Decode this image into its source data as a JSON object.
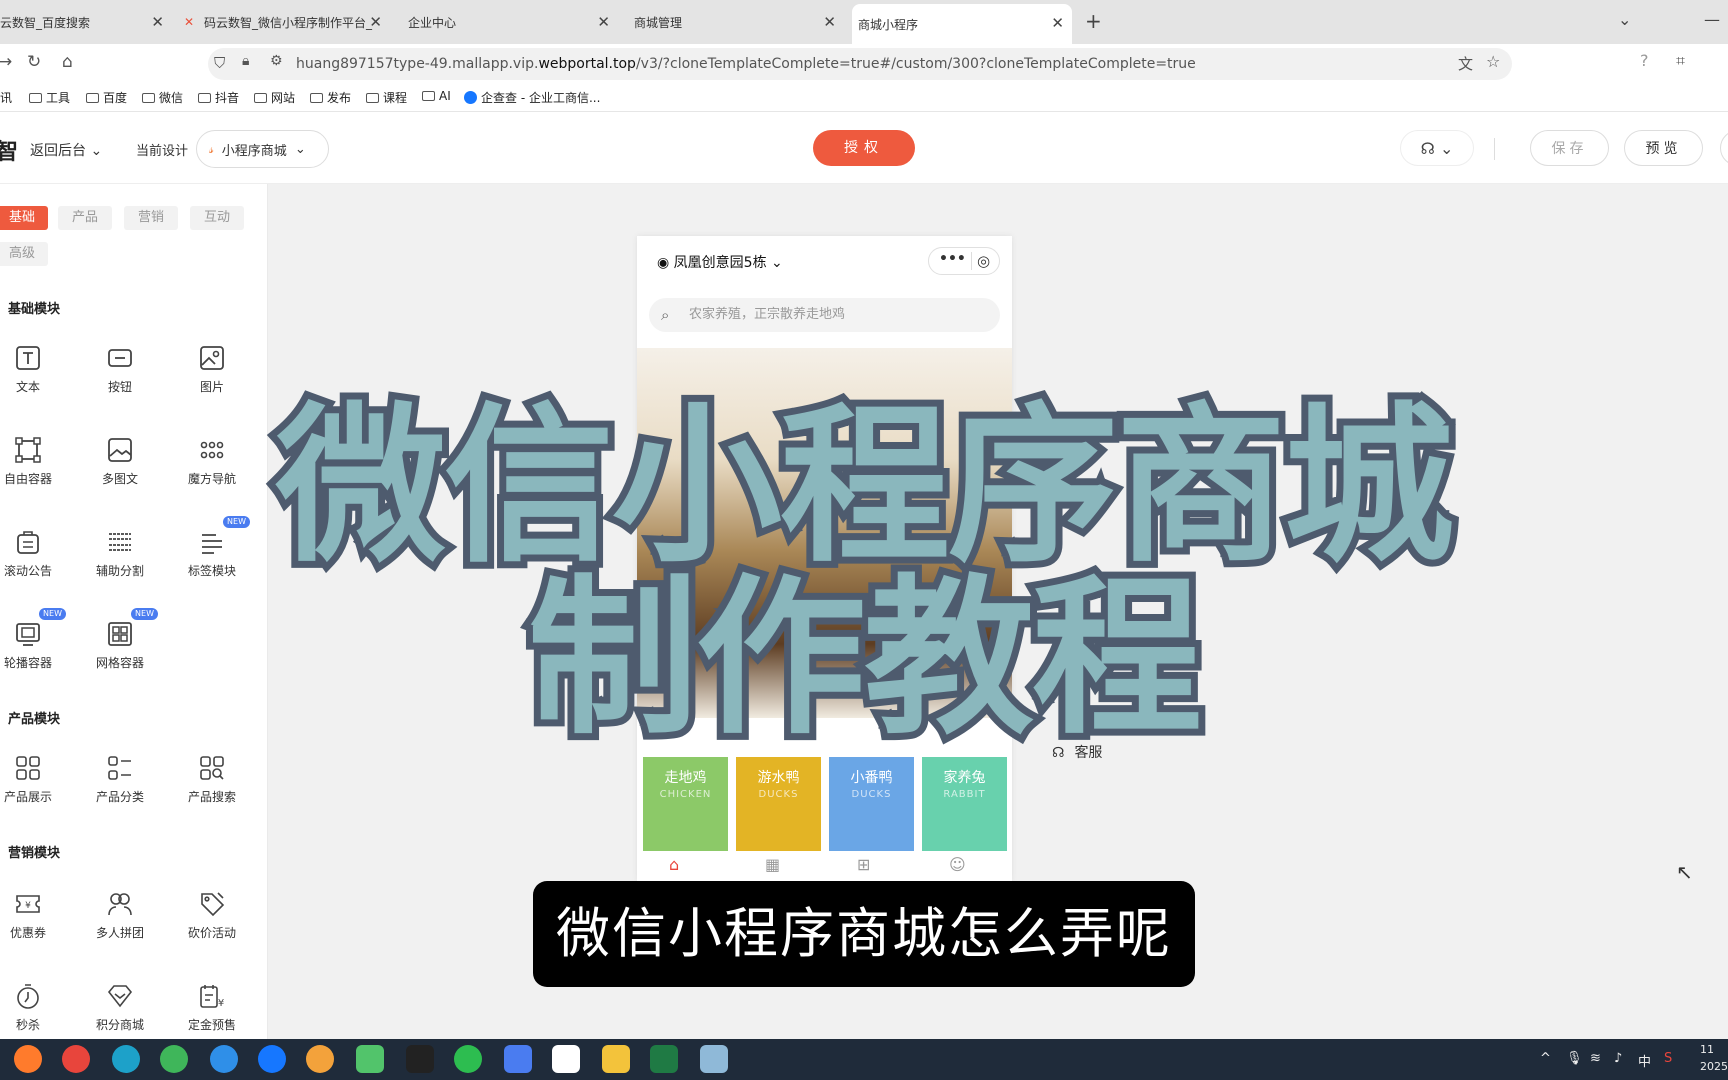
{
  "browser": {
    "tabs": [
      {
        "title": "云数智_百度搜索",
        "active": false
      },
      {
        "title": "码云数智_微信小程序制作平台_",
        "active": false
      },
      {
        "title": "企业中心",
        "active": false
      },
      {
        "title": "商城管理",
        "active": false
      },
      {
        "title": "商城小程序",
        "active": true
      }
    ],
    "url_prefix": "huang897157type-49.mallapp.vip.",
    "url_domain": "webportal.top",
    "url_suffix": "/v3/?cloneTemplateComplete=true#/custom/300?cloneTemplateComplete=true",
    "bookmarks": [
      "讯",
      "工具",
      "百度",
      "微信",
      "抖音",
      "网站",
      "发布",
      "课程",
      "AI",
      "企查查 - 企业工商信..."
    ]
  },
  "editor": {
    "logo_fragment": "智",
    "back_label": "返回后台",
    "current_design_label": "当前设计",
    "shop_selector": "小程序商城",
    "auth_button": "授权",
    "save_button": "保存",
    "preview_button": "预览"
  },
  "left_panel": {
    "tabs": [
      "基础",
      "产品",
      "营销",
      "互动",
      "高级"
    ],
    "active_tab": "基础",
    "sections": {
      "basic": {
        "title": "基础模块",
        "items": [
          "文本",
          "按钮",
          "图片",
          "自由容器",
          "多图文",
          "魔方导航",
          "滚动公告",
          "辅助分割",
          "标签模块",
          "轮播容器",
          "网格容器"
        ]
      },
      "product": {
        "title": "产品模块",
        "items": [
          "产品展示",
          "产品分类",
          "产品搜索"
        ]
      },
      "marketing": {
        "title": "营销模块",
        "items": [
          "优惠券",
          "多人拼团",
          "砍价活动",
          "秒杀",
          "积分商城",
          "定金预售"
        ]
      }
    },
    "new_badge": "NEW"
  },
  "phone": {
    "location": "凤凰创意园5栋",
    "search_placeholder": "农家养殖，正宗散养走地鸡",
    "categories": [
      {
        "cn": "走地鸡",
        "en": "CHICKEN",
        "color": "#8cc968"
      },
      {
        "cn": "游水鸭",
        "en": "DUCKS",
        "color": "#e3b425"
      },
      {
        "cn": "小番鸭",
        "en": "DUCKS",
        "color": "#6aa6e6"
      },
      {
        "cn": "家养兔",
        "en": "RABBIT",
        "color": "#68d1ad"
      }
    ]
  },
  "canvas": {
    "customer_service": "客服"
  },
  "overlay": {
    "title_line1": "微信小程序商城",
    "title_line2": "制作教程",
    "subtitle": "微信小程序商城怎么弄呢"
  },
  "taskbar": {
    "ime": "中",
    "time": "11",
    "date": "2025"
  },
  "colors": {
    "accent": "#ee5a3e",
    "title_fill": "#8ab7bd",
    "title_stroke": "#4e5b6e"
  }
}
